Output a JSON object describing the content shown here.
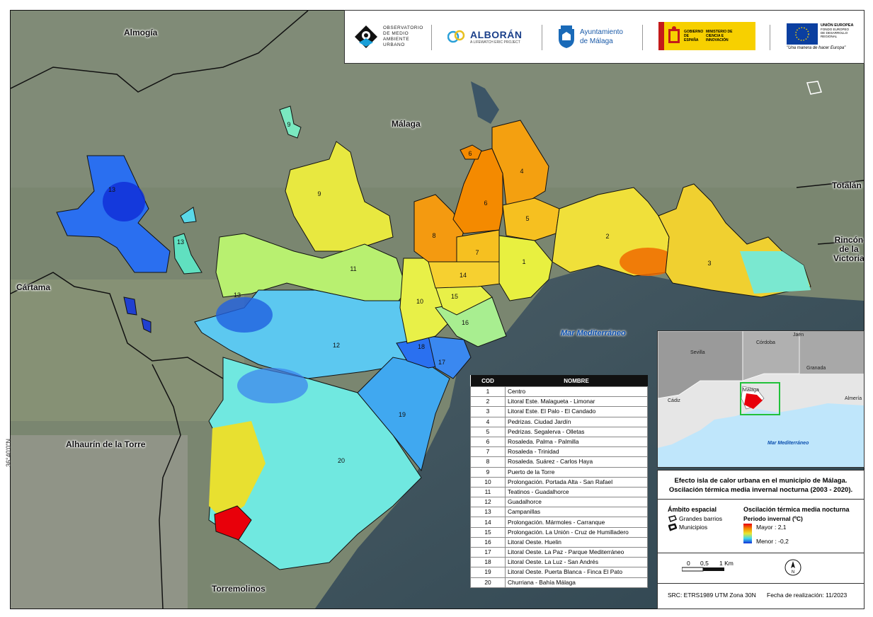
{
  "places": {
    "almogia": "Almogía",
    "malaga": "Málaga",
    "totalan": "Totalán",
    "rincon": "Rincón de la Victoria",
    "rincon_l1": "Rincón",
    "rincon_l2": "de la",
    "rincon_l3": "Victoria",
    "cartama": "Cártama",
    "alhaurin": "Alhaurín de la Torre",
    "torremolinos": "Torremolinos",
    "sea": "Mar Mediterráneo"
  },
  "latitude_label": "36°40'0\"N",
  "district_codes": [
    "1",
    "2",
    "3",
    "4",
    "5",
    "6",
    "6",
    "7",
    "8",
    "9",
    "9",
    "10",
    "11",
    "12",
    "13",
    "13",
    "13",
    "14",
    "15",
    "16",
    "17",
    "18",
    "19",
    "20"
  ],
  "logos": {
    "observatorio": "OBSERVATORIO DE MEDIO AMBIENTE URBANO",
    "alboran": "ALBORÁN",
    "alboran_sub": "A LIFEWATCH ERIC PROJECT",
    "ayto_l1": "Ayuntamiento",
    "ayto_l2": "de Málaga",
    "gobierno": "GOBIERNO DE ESPAÑA",
    "ministerio": "MINISTERIO DE CIENCIA E INNOVACIÓN",
    "ue": "UNIÓN EUROPEA",
    "ue_fund": "FONDO EUROPEO DE DESARROLLO REGIONAL",
    "ue_motto": "\"Una manera de hacer Europa\""
  },
  "table": {
    "headers": [
      "COD",
      "NOMBRE"
    ],
    "rows": [
      [
        "1",
        "Centro"
      ],
      [
        "2",
        "Litoral Este. Malagueta - Limonar"
      ],
      [
        "3",
        "Litoral Este. El Palo - El Candado"
      ],
      [
        "4",
        "Pedrizas. Ciudad Jardín"
      ],
      [
        "5",
        "Pedrizas. Segalerva - Olletas"
      ],
      [
        "6",
        "Rosaleda. Palma - Palmilla"
      ],
      [
        "7",
        "Rosaleda - Trinidad"
      ],
      [
        "8",
        "Rosaleda. Suárez - Carlos Haya"
      ],
      [
        "9",
        "Puerto de la Torre"
      ],
      [
        "10",
        "Prolongación. Portada Alta - San Rafael"
      ],
      [
        "11",
        "Teatinos - Guadalhorce"
      ],
      [
        "12",
        "Guadalhorce"
      ],
      [
        "13",
        "Campanillas"
      ],
      [
        "14",
        "Prolongación. Mármoles - Carranque"
      ],
      [
        "15",
        "Prolongación. La Unión - Cruz de Humilladero"
      ],
      [
        "16",
        "Litoral Oeste. Huelin"
      ],
      [
        "17",
        "Litoral Oeste. La Paz - Parque Mediterráneo"
      ],
      [
        "18",
        "Litoral Oeste. La Luz - San Andrés"
      ],
      [
        "19",
        "Litoral Oeste. Puerta Blanca - Finca El Pato"
      ],
      [
        "20",
        "Churriana - Bahía Málaga"
      ]
    ]
  },
  "inset": {
    "cities": [
      "Córdoba",
      "Jaén",
      "Sevilla",
      "Granada",
      "Cádiz",
      "Málaga",
      "Almería"
    ],
    "sea": "Mar Mediterráneo"
  },
  "panel": {
    "title_l1": "Efecto isla de calor urbana en el municipio de Málaga.",
    "title_l2": "Oscilación térmica media invernal nocturna (2003 - 2020).",
    "ambito": "Ámbito espacial",
    "grandes": "Grandes barrios",
    "municipios": "Municipios",
    "osc": "Oscilación térmica media nocturna",
    "periodo": "Periodo invernal (ºC)",
    "mayor": "Mayor : 2,1",
    "menor": "Menor : -0,2",
    "scale": [
      "0",
      "0,5",
      "1 Km"
    ],
    "north": "N",
    "src": "SRC: ETRS1989 UTM Zona 30N",
    "fecha": "Fecha de realización: 11/2023"
  },
  "colors": {
    "hot": "#e8000a",
    "warm": "#f58a00",
    "mid": "#e8e830",
    "cool": "#3fd8ee",
    "cold": "#1030d8"
  }
}
